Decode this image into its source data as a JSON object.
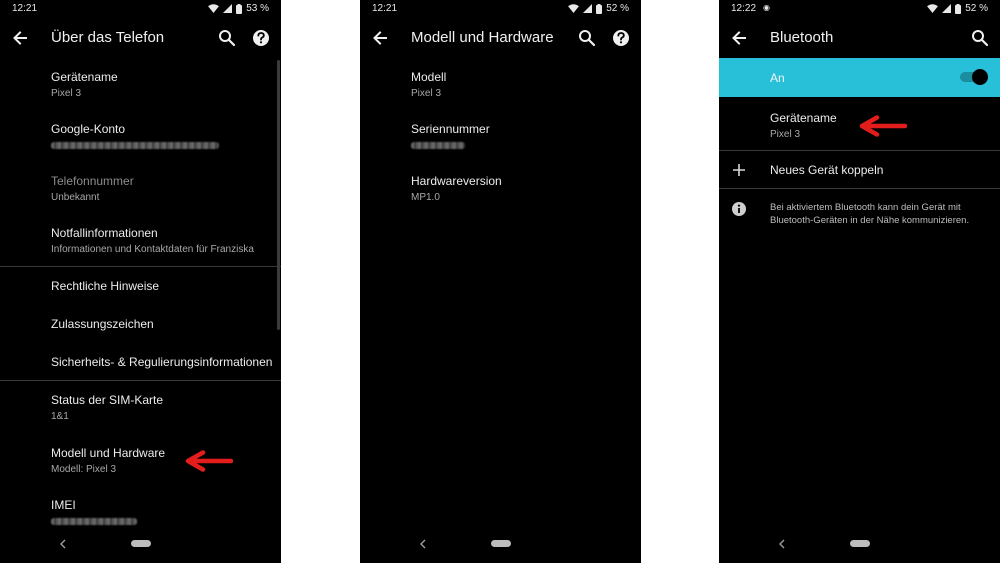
{
  "colors": {
    "background": "#000000",
    "accent": "#27c0d8",
    "arrow": "#e31c1c",
    "text_primary": "#ececec",
    "text_secondary": "#a9a9a9"
  },
  "screen1": {
    "status": {
      "time": "12:21",
      "battery": "53 %"
    },
    "title": "Über das Telefon",
    "actions": [
      "search-icon",
      "help-icon"
    ],
    "items": [
      {
        "title": "Gerätename",
        "subtitle": "Pixel 3"
      },
      {
        "title": "Google-Konto",
        "subtitle_redacted": true
      },
      {
        "title": "Telefonnummer",
        "subtitle": "Unbekannt",
        "disabled": true
      },
      {
        "title": "Notfallinformationen",
        "subtitle": "Informationen und Kontaktdaten für Franziska"
      },
      {
        "title": "Rechtliche Hinweise"
      },
      {
        "title": "Zulassungszeichen"
      },
      {
        "title": "Sicherheits- & Regulierungsinformationen"
      },
      {
        "title": "Status der SIM-Karte",
        "subtitle": "1&1"
      },
      {
        "title": "Modell und Hardware",
        "subtitle": "Modell: Pixel 3"
      },
      {
        "title": "IMEI",
        "subtitle_redacted": true
      }
    ]
  },
  "screen2": {
    "status": {
      "time": "12:21",
      "battery": "52 %"
    },
    "title": "Modell und Hardware",
    "actions": [
      "search-icon",
      "help-icon"
    ],
    "items": [
      {
        "title": "Modell",
        "subtitle": "Pixel 3"
      },
      {
        "title": "Seriennummer",
        "subtitle_redacted": true
      },
      {
        "title": "Hardwareversion",
        "subtitle": "MP1.0"
      }
    ]
  },
  "screen3": {
    "status": {
      "time": "12:22",
      "battery": "52 %"
    },
    "title": "Bluetooth",
    "actions": [
      "search-icon"
    ],
    "toggle": {
      "label": "An",
      "on": true
    },
    "device_name": {
      "title": "Gerätename",
      "subtitle": "Pixel 3"
    },
    "pair": {
      "label": "Neues Gerät koppeln"
    },
    "info": "Bei aktiviertem Bluetooth kann dein Gerät mit Bluetooth-Geräten in der Nähe kommunizieren."
  }
}
